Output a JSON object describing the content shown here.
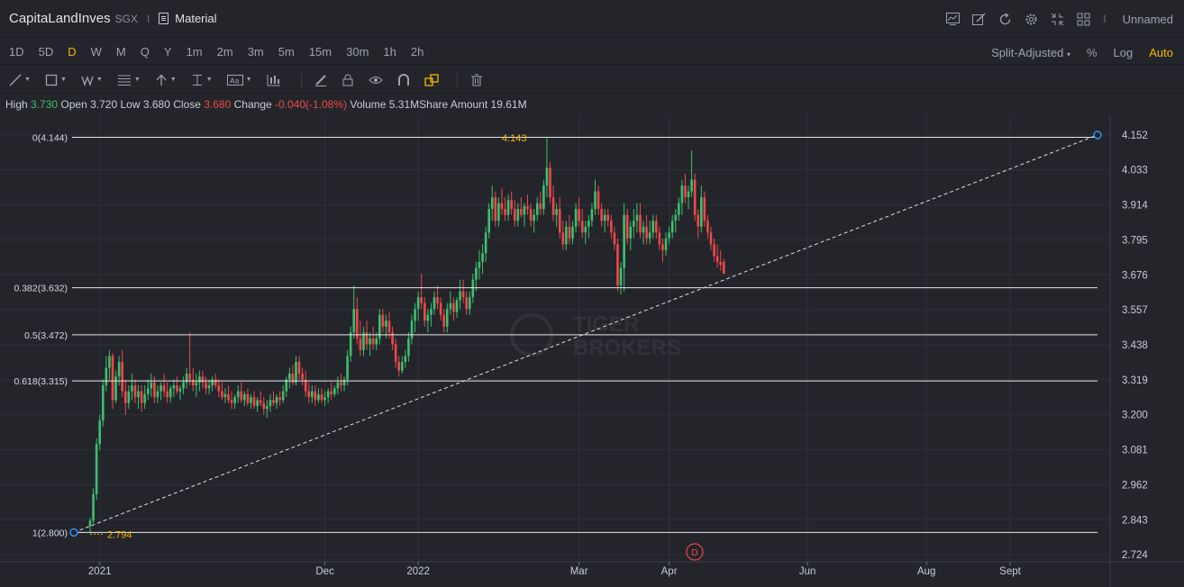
{
  "header": {
    "symbol": "CapitaLandInves",
    "exchange": "SGX",
    "separator": "I",
    "sector": "Material",
    "layout_name": "Unnamed",
    "icons": [
      "indicator-icon",
      "draw-icon",
      "refresh-icon",
      "settings-icon",
      "fullscreen-icon",
      "layout-icon"
    ]
  },
  "periods": [
    "1D",
    "5D",
    "D",
    "W",
    "M",
    "Q",
    "Y",
    "1m",
    "2m",
    "3m",
    "5m",
    "15m",
    "30m",
    "1h",
    "2h"
  ],
  "active_period": "D",
  "price_options": {
    "adjust": "Split-Adjusted",
    "percent": "%",
    "log": "Log",
    "auto": "Auto"
  },
  "tools": [
    "line-tool-icon",
    "rectangle-tool-icon",
    "wave-tool-icon",
    "fib-tool-icon",
    "arrow-tool-icon",
    "measure-tool-icon",
    "text-tool-icon",
    "chart-type-icon",
    "pencil-icon",
    "lock-icon",
    "eye-icon",
    "magnet-icon",
    "link-icon",
    "trash-icon"
  ],
  "quote": {
    "high_label": "High",
    "high": "3.730",
    "open_label": "Open",
    "open": "3.720",
    "low_label": "Low",
    "low": "3.680",
    "close_label": "Close",
    "close": "3.680",
    "change_label": "Change",
    "change": "-0.040(-1.08%)",
    "volume_label": "Volume",
    "volume": "5.31M",
    "amount_label": "Share Amount",
    "amount": "19.61M"
  },
  "watermark": [
    "TIGER",
    "BROKERS"
  ],
  "event_marker": "D",
  "colors": {
    "up": "#3fbf6e",
    "down": "#f04848",
    "accent": "#f5b700",
    "background": "#23252b",
    "fib_line": "#e8e8e8",
    "trend_line": "#e0e0e0"
  },
  "chart_data": {
    "type": "candlestick",
    "ylim": [
      2.7,
      4.17
    ],
    "y_ticks": [
      "4.152",
      "4.033",
      "3.914",
      "3.795",
      "3.676",
      "3.557",
      "3.438",
      "3.319",
      "3.200",
      "3.081",
      "2.962",
      "2.843",
      "2.724"
    ],
    "x_ticks": [
      "2021",
      "Dec",
      "2022",
      "Mar",
      "Apr",
      "Jun",
      "Aug",
      "Sept"
    ],
    "peak_label": "4.143",
    "trough_label": "2.794",
    "fib_levels": [
      {
        "label": "0(4.144)",
        "value": 4.144
      },
      {
        "label": "0.382(3.632)",
        "value": 3.632
      },
      {
        "label": "0.5(3.472)",
        "value": 3.472
      },
      {
        "label": "0.618(3.315)",
        "value": 3.315
      },
      {
        "label": "1(2.800)",
        "value": 2.8
      }
    ],
    "trend_line": {
      "from": {
        "bar": 0,
        "value": 2.8
      },
      "to": {
        "bar": 270,
        "value": 4.152
      }
    },
    "bars": [
      [
        2.82,
        2.85,
        2.8,
        2.84
      ],
      [
        2.84,
        2.95,
        2.83,
        2.93
      ],
      [
        2.93,
        3.12,
        2.91,
        3.1
      ],
      [
        3.1,
        3.2,
        3.08,
        3.18
      ],
      [
        3.18,
        3.32,
        3.16,
        3.3
      ],
      [
        3.3,
        3.4,
        3.28,
        3.36
      ],
      [
        3.36,
        3.42,
        3.32,
        3.4
      ],
      [
        3.4,
        3.41,
        3.22,
        3.25
      ],
      [
        3.25,
        3.35,
        3.24,
        3.33
      ],
      [
        3.33,
        3.4,
        3.3,
        3.38
      ],
      [
        3.38,
        3.42,
        3.26,
        3.28
      ],
      [
        3.28,
        3.32,
        3.2,
        3.24
      ],
      [
        3.24,
        3.3,
        3.22,
        3.28
      ],
      [
        3.28,
        3.34,
        3.25,
        3.3
      ],
      [
        3.3,
        3.32,
        3.24,
        3.26
      ],
      [
        3.26,
        3.3,
        3.22,
        3.28
      ],
      [
        3.28,
        3.3,
        3.21,
        3.24
      ],
      [
        3.24,
        3.3,
        3.22,
        3.27
      ],
      [
        3.27,
        3.32,
        3.25,
        3.29
      ],
      [
        3.29,
        3.34,
        3.26,
        3.31
      ],
      [
        3.31,
        3.33,
        3.24,
        3.26
      ],
      [
        3.26,
        3.3,
        3.24,
        3.28
      ],
      [
        3.28,
        3.31,
        3.25,
        3.3
      ],
      [
        3.3,
        3.34,
        3.26,
        3.28
      ],
      [
        3.28,
        3.31,
        3.24,
        3.26
      ],
      [
        3.26,
        3.3,
        3.24,
        3.29
      ],
      [
        3.29,
        3.32,
        3.26,
        3.3
      ],
      [
        3.3,
        3.33,
        3.27,
        3.28
      ],
      [
        3.28,
        3.3,
        3.25,
        3.29
      ],
      [
        3.29,
        3.33,
        3.27,
        3.31
      ],
      [
        3.31,
        3.36,
        3.29,
        3.34
      ],
      [
        3.34,
        3.48,
        3.3,
        3.32
      ],
      [
        3.32,
        3.36,
        3.28,
        3.3
      ],
      [
        3.3,
        3.34,
        3.26,
        3.31
      ],
      [
        3.31,
        3.35,
        3.28,
        3.33
      ],
      [
        3.33,
        3.35,
        3.29,
        3.31
      ],
      [
        3.31,
        3.33,
        3.27,
        3.29
      ],
      [
        3.29,
        3.32,
        3.27,
        3.3
      ],
      [
        3.3,
        3.33,
        3.28,
        3.32
      ],
      [
        3.32,
        3.34,
        3.29,
        3.3
      ],
      [
        3.3,
        3.32,
        3.26,
        3.28
      ],
      [
        3.28,
        3.31,
        3.25,
        3.26
      ],
      [
        3.26,
        3.29,
        3.24,
        3.27
      ],
      [
        3.27,
        3.3,
        3.24,
        3.25
      ],
      [
        3.25,
        3.28,
        3.22,
        3.24
      ],
      [
        3.24,
        3.27,
        3.22,
        3.26
      ],
      [
        3.26,
        3.3,
        3.24,
        3.28
      ],
      [
        3.28,
        3.31,
        3.24,
        3.25
      ],
      [
        3.25,
        3.28,
        3.23,
        3.27
      ],
      [
        3.27,
        3.29,
        3.23,
        3.24
      ],
      [
        3.24,
        3.27,
        3.22,
        3.26
      ],
      [
        3.26,
        3.28,
        3.22,
        3.23
      ],
      [
        3.23,
        3.26,
        3.21,
        3.25
      ],
      [
        3.25,
        3.28,
        3.23,
        3.24
      ],
      [
        3.24,
        3.26,
        3.2,
        3.22
      ],
      [
        3.22,
        3.25,
        3.19,
        3.23
      ],
      [
        3.23,
        3.27,
        3.21,
        3.25
      ],
      [
        3.25,
        3.28,
        3.23,
        3.24
      ],
      [
        3.24,
        3.27,
        3.22,
        3.26
      ],
      [
        3.26,
        3.28,
        3.23,
        3.25
      ],
      [
        3.25,
        3.3,
        3.24,
        3.28
      ],
      [
        3.28,
        3.33,
        3.26,
        3.32
      ],
      [
        3.32,
        3.36,
        3.29,
        3.34
      ],
      [
        3.34,
        3.37,
        3.3,
        3.31
      ],
      [
        3.31,
        3.4,
        3.3,
        3.38
      ],
      [
        3.38,
        3.4,
        3.32,
        3.34
      ],
      [
        3.34,
        3.36,
        3.3,
        3.32
      ],
      [
        3.32,
        3.35,
        3.26,
        3.28
      ],
      [
        3.28,
        3.31,
        3.24,
        3.26
      ],
      [
        3.26,
        3.3,
        3.24,
        3.28
      ],
      [
        3.28,
        3.3,
        3.23,
        3.25
      ],
      [
        3.25,
        3.29,
        3.24,
        3.27
      ],
      [
        3.27,
        3.29,
        3.24,
        3.25
      ],
      [
        3.25,
        3.28,
        3.23,
        3.26
      ],
      [
        3.26,
        3.29,
        3.24,
        3.28
      ],
      [
        3.28,
        3.31,
        3.25,
        3.27
      ],
      [
        3.27,
        3.3,
        3.26,
        3.29
      ],
      [
        3.29,
        3.33,
        3.27,
        3.31
      ],
      [
        3.31,
        3.34,
        3.28,
        3.3
      ],
      [
        3.3,
        3.33,
        3.28,
        3.32
      ],
      [
        3.32,
        3.42,
        3.3,
        3.4
      ],
      [
        3.4,
        3.5,
        3.38,
        3.48
      ],
      [
        3.48,
        3.64,
        3.46,
        3.56
      ],
      [
        3.56,
        3.6,
        3.44,
        3.46
      ],
      [
        3.46,
        3.52,
        3.4,
        3.42
      ],
      [
        3.42,
        3.5,
        3.4,
        3.48
      ],
      [
        3.48,
        3.52,
        3.42,
        3.44
      ],
      [
        3.44,
        3.48,
        3.4,
        3.46
      ],
      [
        3.46,
        3.5,
        3.42,
        3.44
      ],
      [
        3.44,
        3.48,
        3.42,
        3.46
      ],
      [
        3.46,
        3.56,
        3.44,
        3.54
      ],
      [
        3.54,
        3.56,
        3.48,
        3.5
      ],
      [
        3.5,
        3.54,
        3.46,
        3.52
      ],
      [
        3.52,
        3.55,
        3.46,
        3.48
      ],
      [
        3.48,
        3.5,
        3.42,
        3.44
      ],
      [
        3.44,
        3.46,
        3.36,
        3.38
      ],
      [
        3.38,
        3.4,
        3.33,
        3.35
      ],
      [
        3.35,
        3.4,
        3.34,
        3.38
      ],
      [
        3.38,
        3.42,
        3.36,
        3.4
      ],
      [
        3.4,
        3.48,
        3.38,
        3.46
      ],
      [
        3.46,
        3.54,
        3.44,
        3.52
      ],
      [
        3.52,
        3.58,
        3.48,
        3.56
      ],
      [
        3.56,
        3.62,
        3.52,
        3.6
      ],
      [
        3.6,
        3.68,
        3.56,
        3.58
      ],
      [
        3.58,
        3.6,
        3.5,
        3.52
      ],
      [
        3.52,
        3.56,
        3.48,
        3.54
      ],
      [
        3.54,
        3.58,
        3.5,
        3.56
      ],
      [
        3.56,
        3.62,
        3.54,
        3.6
      ],
      [
        3.6,
        3.64,
        3.56,
        3.58
      ],
      [
        3.58,
        3.6,
        3.52,
        3.54
      ],
      [
        3.54,
        3.56,
        3.48,
        3.5
      ],
      [
        3.5,
        3.58,
        3.48,
        3.56
      ],
      [
        3.56,
        3.62,
        3.54,
        3.58
      ],
      [
        3.58,
        3.6,
        3.52,
        3.55
      ],
      [
        3.55,
        3.6,
        3.53,
        3.59
      ],
      [
        3.59,
        3.66,
        3.56,
        3.62
      ],
      [
        3.62,
        3.66,
        3.58,
        3.6
      ],
      [
        3.6,
        3.62,
        3.54,
        3.56
      ],
      [
        3.56,
        3.62,
        3.54,
        3.6
      ],
      [
        3.6,
        3.68,
        3.58,
        3.66
      ],
      [
        3.66,
        3.72,
        3.62,
        3.7
      ],
      [
        3.7,
        3.76,
        3.66,
        3.72
      ],
      [
        3.72,
        3.78,
        3.68,
        3.75
      ],
      [
        3.75,
        3.84,
        3.72,
        3.82
      ],
      [
        3.82,
        3.92,
        3.8,
        3.9
      ],
      [
        3.9,
        3.98,
        3.86,
        3.94
      ],
      [
        3.94,
        3.96,
        3.84,
        3.86
      ],
      [
        3.86,
        3.94,
        3.84,
        3.92
      ],
      [
        3.92,
        3.97,
        3.88,
        3.9
      ],
      [
        3.9,
        3.94,
        3.86,
        3.88
      ],
      [
        3.88,
        3.95,
        3.86,
        3.93
      ],
      [
        3.93,
        3.96,
        3.88,
        3.9
      ],
      [
        3.9,
        3.93,
        3.84,
        3.86
      ],
      [
        3.86,
        3.92,
        3.84,
        3.9
      ],
      [
        3.9,
        3.94,
        3.87,
        3.88
      ],
      [
        3.88,
        3.92,
        3.84,
        3.91
      ],
      [
        3.91,
        3.95,
        3.88,
        3.9
      ],
      [
        3.9,
        3.92,
        3.84,
        3.86
      ],
      [
        3.86,
        3.9,
        3.82,
        3.88
      ],
      [
        3.88,
        3.94,
        3.86,
        3.92
      ],
      [
        3.92,
        3.96,
        3.88,
        3.9
      ],
      [
        3.9,
        4.0,
        3.88,
        3.98
      ],
      [
        3.98,
        4.143,
        3.94,
        4.04
      ],
      [
        4.04,
        4.06,
        3.92,
        3.94
      ],
      [
        3.94,
        3.98,
        3.86,
        3.88
      ],
      [
        3.88,
        3.92,
        3.84,
        3.9
      ],
      [
        3.9,
        3.94,
        3.8,
        3.82
      ],
      [
        3.82,
        3.86,
        3.76,
        3.78
      ],
      [
        3.78,
        3.86,
        3.76,
        3.84
      ],
      [
        3.84,
        3.88,
        3.78,
        3.8
      ],
      [
        3.8,
        3.86,
        3.78,
        3.84
      ],
      [
        3.84,
        3.92,
        3.82,
        3.9
      ],
      [
        3.9,
        3.94,
        3.84,
        3.86
      ],
      [
        3.86,
        3.9,
        3.8,
        3.82
      ],
      [
        3.82,
        3.86,
        3.78,
        3.84
      ],
      [
        3.84,
        3.88,
        3.8,
        3.86
      ],
      [
        3.86,
        3.92,
        3.84,
        3.9
      ],
      [
        3.9,
        4.0,
        3.88,
        3.96
      ],
      [
        3.96,
        3.98,
        3.88,
        3.9
      ],
      [
        3.9,
        3.92,
        3.84,
        3.86
      ],
      [
        3.86,
        3.9,
        3.82,
        3.88
      ],
      [
        3.88,
        3.9,
        3.84,
        3.86
      ],
      [
        3.86,
        3.88,
        3.8,
        3.82
      ],
      [
        3.82,
        3.84,
        3.76,
        3.78
      ],
      [
        3.78,
        3.8,
        3.62,
        3.64
      ],
      [
        3.64,
        3.72,
        3.61,
        3.7
      ],
      [
        3.7,
        3.92,
        3.62,
        3.88
      ],
      [
        3.88,
        3.9,
        3.78,
        3.8
      ],
      [
        3.8,
        3.86,
        3.76,
        3.84
      ],
      [
        3.84,
        3.9,
        3.8,
        3.86
      ],
      [
        3.86,
        3.92,
        3.82,
        3.88
      ],
      [
        3.88,
        3.92,
        3.8,
        3.82
      ],
      [
        3.82,
        3.86,
        3.78,
        3.84
      ],
      [
        3.84,
        3.88,
        3.78,
        3.8
      ],
      [
        3.8,
        3.86,
        3.78,
        3.82
      ],
      [
        3.82,
        3.88,
        3.8,
        3.86
      ],
      [
        3.86,
        3.88,
        3.8,
        3.82
      ],
      [
        3.82,
        3.84,
        3.76,
        3.78
      ],
      [
        3.78,
        3.8,
        3.72,
        3.76
      ],
      [
        3.76,
        3.82,
        3.74,
        3.8
      ],
      [
        3.8,
        3.84,
        3.78,
        3.82
      ],
      [
        3.82,
        3.88,
        3.8,
        3.86
      ],
      [
        3.86,
        3.9,
        3.82,
        3.88
      ],
      [
        3.88,
        3.94,
        3.86,
        3.92
      ],
      [
        3.92,
        4.0,
        3.88,
        3.98
      ],
      [
        3.98,
        4.02,
        3.92,
        3.94
      ],
      [
        3.94,
        3.98,
        3.9,
        3.96
      ],
      [
        3.96,
        4.1,
        3.94,
        4.0
      ],
      [
        4.0,
        4.02,
        3.86,
        3.88
      ],
      [
        3.88,
        3.9,
        3.8,
        3.84
      ],
      [
        3.84,
        3.98,
        3.82,
        3.94
      ],
      [
        3.94,
        3.96,
        3.84,
        3.86
      ],
      [
        3.86,
        3.88,
        3.8,
        3.82
      ],
      [
        3.82,
        3.84,
        3.76,
        3.78
      ],
      [
        3.78,
        3.8,
        3.72,
        3.74
      ],
      [
        3.74,
        3.78,
        3.7,
        3.72
      ],
      [
        3.72,
        3.76,
        3.69,
        3.71
      ],
      [
        3.72,
        3.73,
        3.68,
        3.68
      ]
    ],
    "x_tick_bars": [
      3,
      73,
      102,
      152,
      180,
      223,
      260,
      286
    ]
  }
}
